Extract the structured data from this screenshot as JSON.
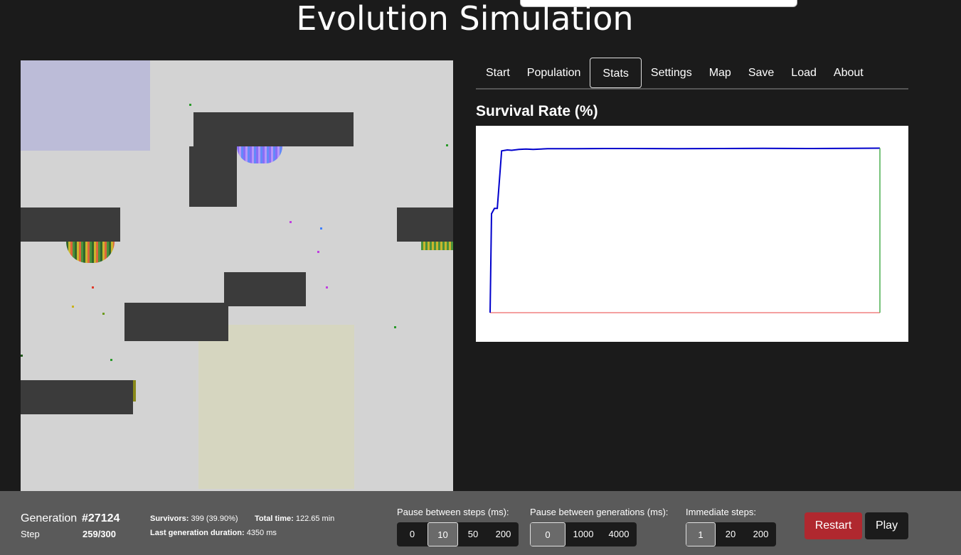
{
  "title": "Evolution Simulation",
  "tabs": [
    {
      "label": "Start"
    },
    {
      "label": "Population"
    },
    {
      "label": "Stats"
    },
    {
      "label": "Settings"
    },
    {
      "label": "Map"
    },
    {
      "label": "Save"
    },
    {
      "label": "Load"
    },
    {
      "label": "About"
    }
  ],
  "active_tab": "Stats",
  "chart_title": "Survival Rate (%)",
  "chart_data": {
    "type": "line",
    "title": "Survival Rate (%)",
    "series": [
      {
        "color": "#0000cc",
        "x": [
          0,
          100,
          300,
          500,
          800,
          1200,
          1500,
          2000,
          2500,
          3000,
          4000,
          6000,
          8000,
          10000,
          13000,
          16000,
          19000,
          22000,
          25000,
          27124
        ],
        "values": [
          0,
          55,
          58,
          58,
          90,
          90.5,
          90.3,
          90.8,
          91,
          90.8,
          91.2,
          91.2,
          91.3,
          91.3,
          91.2,
          91.3,
          91.4,
          91.3,
          91.4,
          91.5
        ]
      }
    ],
    "xlim": [
      0,
      27124
    ],
    "ylim": [
      0,
      100
    ],
    "baseline_color": "#f08080",
    "endline_color": "#4caf50"
  },
  "status": {
    "generation_label": "Generation",
    "generation_value": "#27124",
    "step_label": "Step",
    "step_value": "259/300",
    "survivors_label": "Survivors:",
    "survivors_value": "399 (39.90%)",
    "total_time_label": "Total time:",
    "total_time_value": "122.65 min",
    "last_gen_label": "Last generation duration:",
    "last_gen_value": "4350 ms"
  },
  "controls": {
    "pause_steps": {
      "label": "Pause between steps (ms):",
      "options": [
        "0",
        "10",
        "50",
        "200"
      ],
      "selected": "10"
    },
    "pause_generations": {
      "label": "Pause between generations (ms):",
      "options": [
        "0",
        "1000",
        "4000"
      ],
      "selected": "0"
    },
    "immediate_steps": {
      "label": "Immediate steps:",
      "options": [
        "1",
        "20",
        "200"
      ],
      "selected": "1"
    },
    "restart_label": "Restart",
    "play_label": "Play"
  },
  "colors": {
    "background": "#1b1b1b",
    "canvas": "#d3d3d3",
    "wall": "#3b3b3b",
    "spawn_zone": "#bcbcd8",
    "goal_zone": "#d6d6c0",
    "restart": "#b0282f",
    "bottom_bar": "#5a5a5a"
  }
}
